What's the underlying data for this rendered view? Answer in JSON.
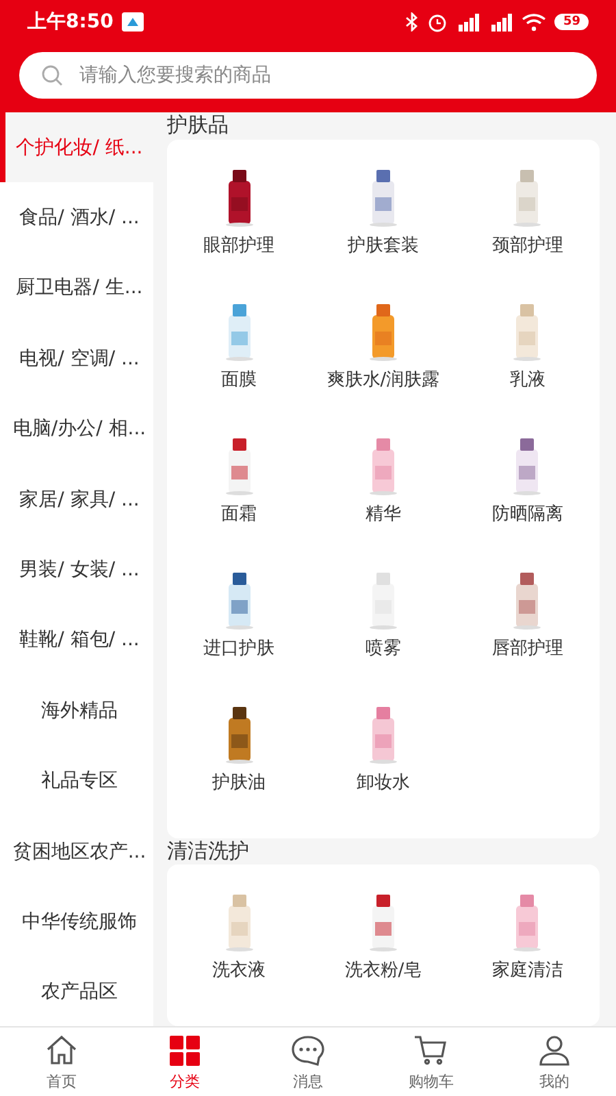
{
  "status_bar": {
    "time": "上午8:50",
    "battery": "59"
  },
  "search": {
    "placeholder": "请输入您要搜索的商品"
  },
  "categories": [
    {
      "label": "个护化妆/ 纸...",
      "selected": true
    },
    {
      "label": "食品/ 酒水/ ...",
      "selected": false
    },
    {
      "label": "厨卫电器/ 生...",
      "selected": false
    },
    {
      "label": "电视/ 空调/ ...",
      "selected": false
    },
    {
      "label": "电脑/办公/ 相...",
      "selected": false
    },
    {
      "label": "家居/ 家具/ ...",
      "selected": false
    },
    {
      "label": "男装/ 女装/ ...",
      "selected": false
    },
    {
      "label": "鞋靴/ 箱包/ ...",
      "selected": false
    },
    {
      "label": "海外精品",
      "selected": false
    },
    {
      "label": "礼品专区",
      "selected": false
    },
    {
      "label": "贫困地区农产...",
      "selected": false
    },
    {
      "label": "中华传统服饰",
      "selected": false
    },
    {
      "label": "农产品区",
      "selected": false
    }
  ],
  "sections": [
    {
      "title": "护肤品",
      "items": [
        "眼部护理",
        "护肤套装",
        "颈部护理",
        "面膜",
        "爽肤水/润肤露",
        "乳液",
        "面霜",
        "精华",
        "防晒隔离",
        "进口护肤",
        "喷雾",
        "唇部护理",
        "护肤油",
        "卸妆水"
      ]
    },
    {
      "title": "清洁洗护",
      "items": [
        "洗衣液",
        "洗衣粉/皂",
        "家庭清洁"
      ]
    }
  ],
  "tab_bar": [
    {
      "label": "首页",
      "kind": "home",
      "selected": false
    },
    {
      "label": "分类",
      "kind": "grid",
      "selected": true
    },
    {
      "label": "消息",
      "kind": "chat",
      "selected": false
    },
    {
      "label": "购物车",
      "kind": "cart",
      "selected": false
    },
    {
      "label": "我的",
      "kind": "user",
      "selected": false
    }
  ]
}
